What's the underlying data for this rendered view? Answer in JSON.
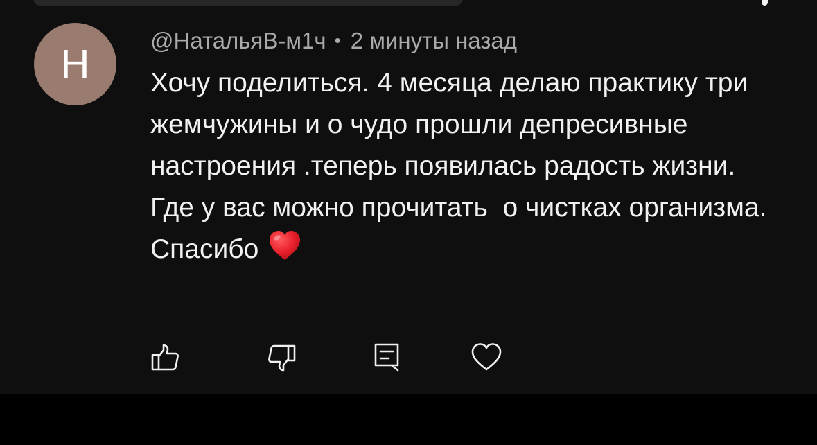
{
  "comment": {
    "avatar_letter": "Н",
    "avatar_color": "#9a7b6f",
    "author": "@НатальяВ-м1ч",
    "separator": "•",
    "timestamp": "2 минуты назад",
    "text": "Хочу поделиться. 4 месяца делаю практику три жемчужины и о чудо прошли депресивные настроения .теперь появилась радость жизни. Где у вас можно прочитать  о чистках организма. Спасибо"
  },
  "actions": {
    "like_icon": "thumbs-up-icon",
    "dislike_icon": "thumbs-down-icon",
    "reply_icon": "reply-comment-icon",
    "heart_icon": "heart-outline-icon"
  },
  "colors": {
    "background": "#0f0f0f",
    "text_primary": "#f1f1f1",
    "text_secondary": "#aaaaaa",
    "heart_emoji": "#e8202a"
  }
}
